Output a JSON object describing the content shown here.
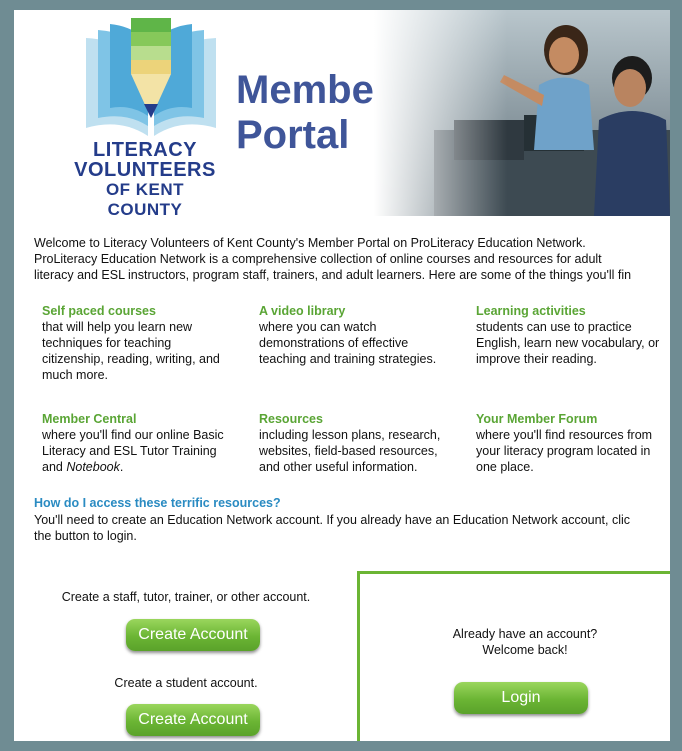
{
  "logo": {
    "line1": "LITERACY",
    "line2": "VOLUNTEERS",
    "line3": "OF KENT COUNTY"
  },
  "title": {
    "line1": "Member",
    "line2": "Portal"
  },
  "intro": {
    "line1": "Welcome to Literacy Volunteers of Kent County's Member Portal on ProLiteracy Education Network.",
    "line2": "ProLiteracy Education Network is a comprehensive collection of online courses and resources for adult",
    "line3": "literacy and ESL instructors, program staff, trainers, and adult learners. Here are some of the things you'll fin"
  },
  "features": [
    {
      "title": "Self paced courses",
      "desc": "that will help you learn new\ntechniques for teaching\ncitizenship, reading, writing, and\nmuch more."
    },
    {
      "title": "A video library",
      "desc": "where you can watch\ndemonstrations of effective\nteaching and training strategies."
    },
    {
      "title": "Learning activities",
      "desc": "students can use to practice\nEnglish, learn new vocabulary, or\nimprove their reading."
    },
    {
      "title": "Member Central",
      "desc": "where you'll find our online Basic\nLiteracy and ESL Tutor Training\nand ",
      "desc_em": "Notebook",
      "desc_end": "."
    },
    {
      "title": "Resources",
      "desc": "including lesson plans, research,\nwebsites, field-based resources,\nand other useful information."
    },
    {
      "title": "Your Member Forum",
      "desc": "where you'll find resources from\nyour literacy program located in\none place."
    }
  ],
  "faq": {
    "question": "How do I access these terrific resources?",
    "answer_line1": "You'll need to create an Education Network account. If you already have an Education Network account, clic",
    "answer_line2": "the button to login."
  },
  "create": {
    "staff_caption": "Create a staff, tutor, trainer, or other account.",
    "staff_button": "Create Account",
    "student_caption": "Create a student account.",
    "student_button": "Create Account"
  },
  "login": {
    "line1": "Already have an account?",
    "line2": "Welcome back!",
    "button": "Login"
  },
  "colors": {
    "frame": "#6f8c93",
    "green": "#6bb534",
    "title_blue": "#3f5599",
    "link_blue": "#2a8bc2",
    "feature_green": "#5aa535"
  }
}
